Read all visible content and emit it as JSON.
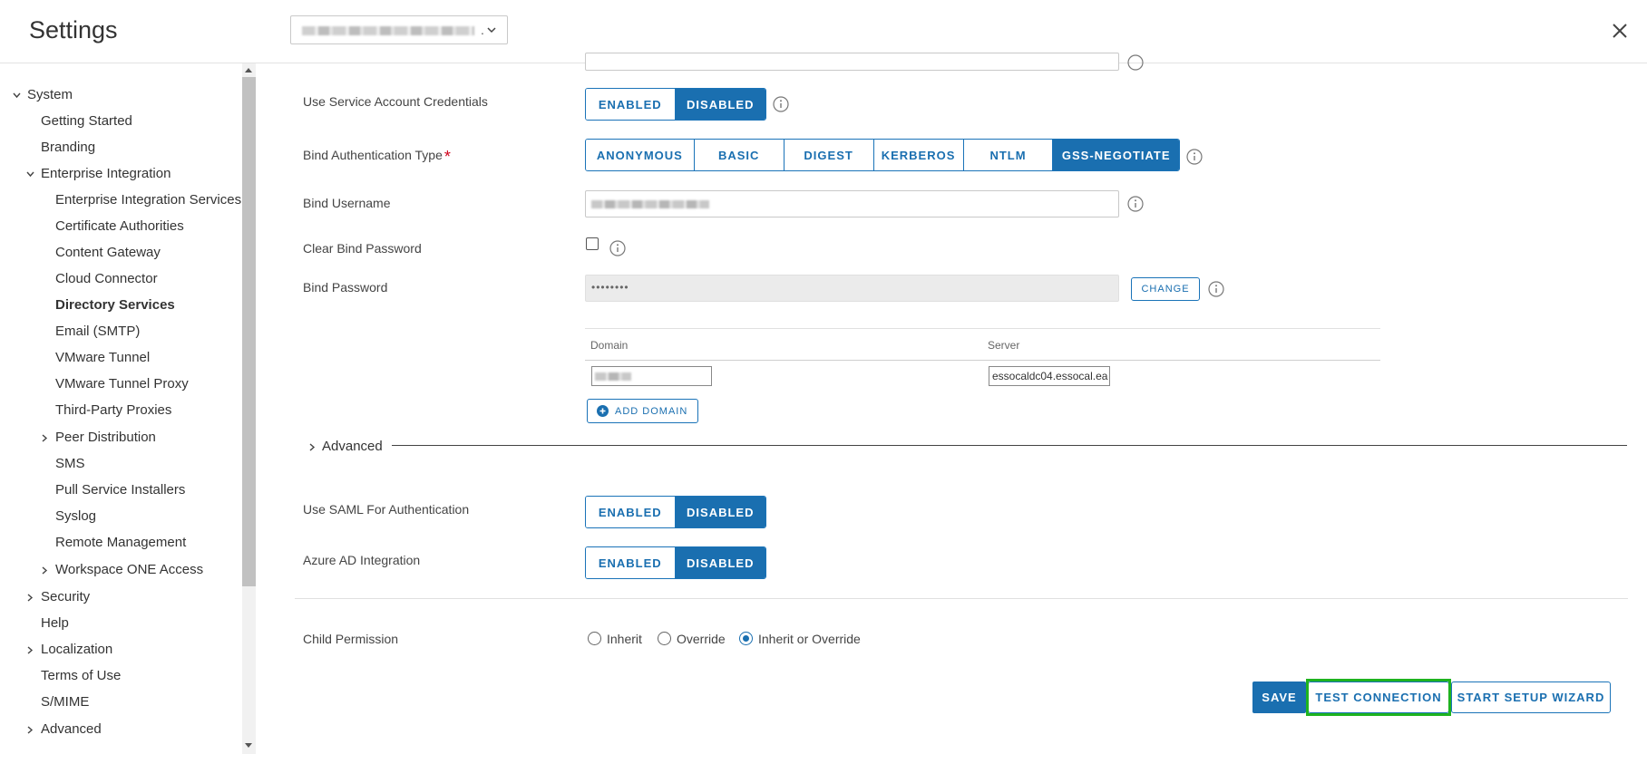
{
  "header": {
    "title": "Settings",
    "org_select_suffix": ". "
  },
  "sidebar": {
    "system": "System",
    "getting_started": "Getting Started",
    "branding": "Branding",
    "enterprise_integration": "Enterprise Integration",
    "ei_services": "Enterprise Integration Services",
    "cert_authorities": "Certificate Authorities",
    "content_gateway": "Content Gateway",
    "cloud_connector": "Cloud Connector",
    "directory_services": "Directory Services",
    "email_smtp": "Email (SMTP)",
    "vmware_tunnel": "VMware Tunnel",
    "vmware_tunnel_proxy": "VMware Tunnel Proxy",
    "third_party_proxies": "Third-Party Proxies",
    "peer_distribution": "Peer Distribution",
    "sms": "SMS",
    "pull_service_installers": "Pull Service Installers",
    "syslog": "Syslog",
    "remote_management": "Remote Management",
    "workspace_one_access": "Workspace ONE Access",
    "security": "Security",
    "help": "Help",
    "localization": "Localization",
    "terms_of_use": "Terms of Use",
    "smime": "S/MIME",
    "advanced": "Advanced"
  },
  "form": {
    "use_service_account": {
      "label": "Use Service Account Credentials",
      "enabled": "ENABLED",
      "disabled": "DISABLED",
      "selected": "DISABLED"
    },
    "bind_auth_type": {
      "label": "Bind Authentication Type",
      "required_mark": "*",
      "options": [
        "ANONYMOUS",
        "BASIC",
        "DIGEST",
        "KERBEROS",
        "NTLM",
        "GSS-NEGOTIATE"
      ],
      "selected": "GSS-NEGOTIATE"
    },
    "bind_username": {
      "label": "Bind Username"
    },
    "clear_bind_password": {
      "label": "Clear Bind Password",
      "checked": false
    },
    "bind_password": {
      "label": "Bind Password",
      "value": "••••••••",
      "change_label": "CHANGE"
    },
    "domain_table": {
      "col_domain": "Domain",
      "col_server": "Server",
      "server_value": "essocaldc04.essocal.ea",
      "add_domain_label": "ADD DOMAIN"
    },
    "advanced_label": "Advanced",
    "use_saml": {
      "label": "Use SAML For Authentication",
      "enabled": "ENABLED",
      "disabled": "DISABLED",
      "selected": "DISABLED"
    },
    "azure_ad": {
      "label": "Azure AD Integration",
      "enabled": "ENABLED",
      "disabled": "DISABLED",
      "selected": "DISABLED"
    },
    "child_permission": {
      "label": "Child Permission",
      "options": [
        "Inherit",
        "Override",
        "Inherit or Override"
      ],
      "selected": "Inherit or Override"
    }
  },
  "actions": {
    "save": "SAVE",
    "test_connection": "TEST CONNECTION",
    "start_setup_wizard": "START SETUP WIZARD"
  },
  "colors": {
    "accent": "#1a6fb0",
    "highlight": "#1fb31f",
    "required": "#d0021b"
  }
}
